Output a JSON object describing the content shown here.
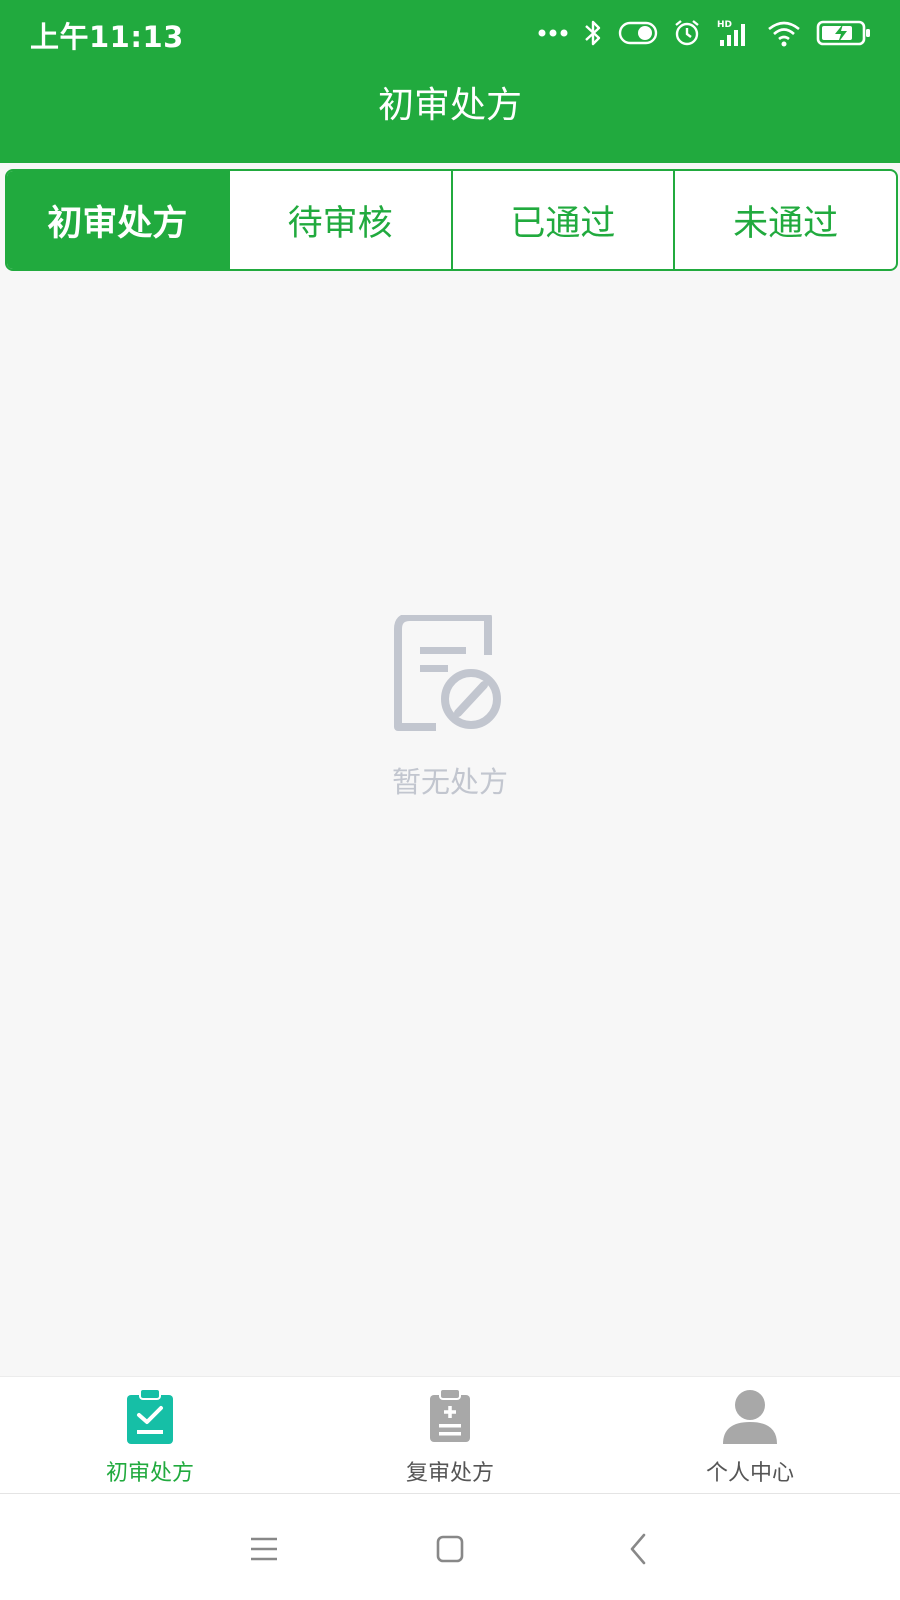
{
  "status_bar": {
    "time": "上午11:13",
    "icons": [
      "more-dots-icon",
      "bluetooth-icon",
      "toggle-icon",
      "alarm-icon",
      "hd-signal-icon",
      "wifi-icon",
      "battery-charging-icon"
    ]
  },
  "header": {
    "title": "初审处方"
  },
  "tabs": [
    {
      "label": "初审处方",
      "active": true
    },
    {
      "label": "待审核",
      "active": false
    },
    {
      "label": "已通过",
      "active": false
    },
    {
      "label": "未通过",
      "active": false
    }
  ],
  "empty_state": {
    "icon": "no-prescription-icon",
    "text": "暂无处方"
  },
  "bottom_nav": [
    {
      "label": "初审处方",
      "icon": "clipboard-check-icon",
      "active": true
    },
    {
      "label": "复审处方",
      "icon": "clipboard-plus-icon",
      "active": false
    },
    {
      "label": "个人中心",
      "icon": "user-icon",
      "active": false
    }
  ],
  "system_nav": [
    "menu-icon",
    "home-icon",
    "back-icon"
  ],
  "colors": {
    "primary": "#21aa3e",
    "active_icon": "#16bfa6",
    "inactive_icon": "#a8a8a8",
    "empty": "#c2c6cf",
    "background": "#f7f7f7"
  }
}
